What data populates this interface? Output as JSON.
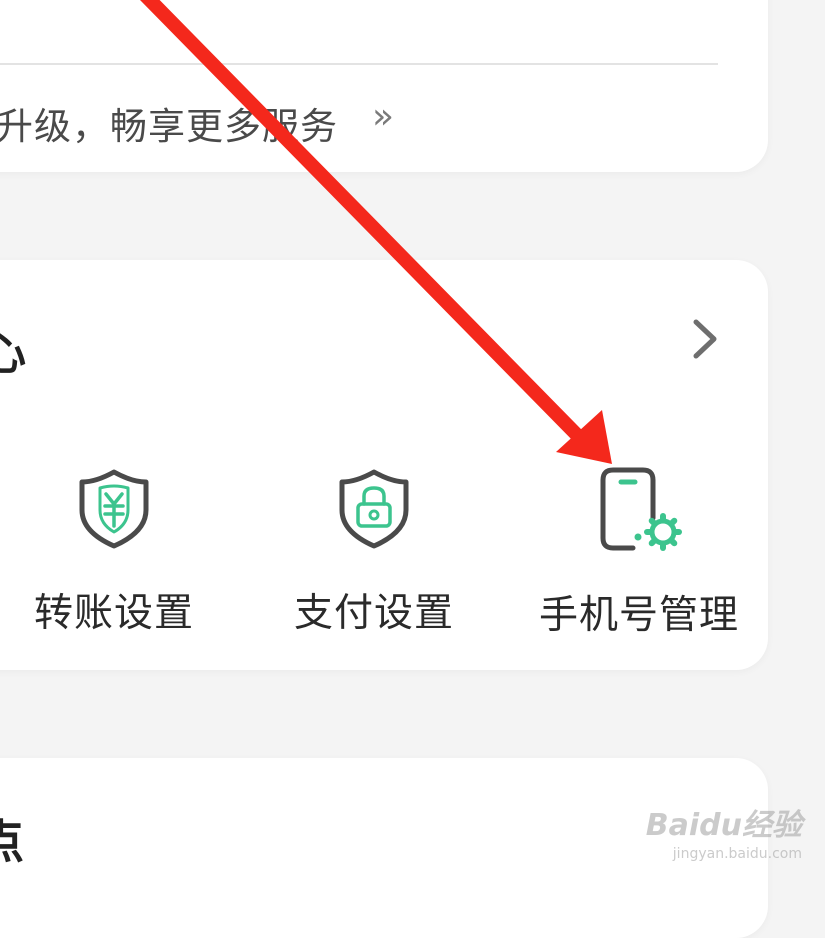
{
  "top_card": {
    "upgrade_text": "升级，畅享更多服务",
    "chevron": "»"
  },
  "section": {
    "title": "心",
    "features": [
      {
        "label": "转账设置",
        "icon": "shield-yuan-icon"
      },
      {
        "label": "支付设置",
        "icon": "shield-lock-icon"
      },
      {
        "label": "手机号管理",
        "icon": "phone-gear-icon"
      }
    ]
  },
  "bottom_card": {
    "title": "点"
  },
  "watermark": {
    "main": "Baidu经验",
    "sub": "jingyan.baidu.com"
  },
  "colors": {
    "accent": "#3cc48e",
    "icon_stroke": "#4a4a4a",
    "arrow": "#f4281c",
    "background": "#f4f4f4",
    "card": "#ffffff"
  }
}
